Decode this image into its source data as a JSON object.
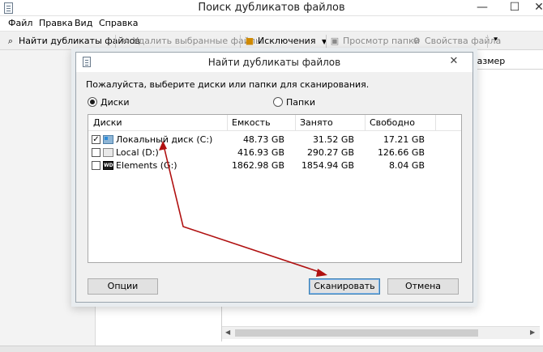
{
  "window": {
    "title": "Поиск дубликатов файлов",
    "controls": {
      "minimize": "—",
      "maximize": "☐",
      "close": "✕"
    }
  },
  "menu": [
    "Файл",
    "Правка",
    "Вид",
    "Справка"
  ],
  "toolbar": {
    "find_duplicates": "Найти дубликаты файлов",
    "delete_selected": "Удалить выбранные файлы",
    "exclusions": "Исключения",
    "view_folder": "Просмотр папки",
    "file_properties": "Свойства файла",
    "overflow": "⯆"
  },
  "main": {
    "column_size": "Размер"
  },
  "dialog": {
    "title": "Найти дубликаты файлов",
    "close": "✕",
    "prompt": "Пожалуйста, выберите диски или папки для сканирования.",
    "radio_disks": "Диски",
    "radio_folders": "Папки",
    "selected_mode": "disks",
    "columns": [
      "Диски",
      "Емкость",
      "Занято",
      "Свободно"
    ],
    "drives": [
      {
        "name": "Локальный диск (C:)",
        "capacity": "48.73 GB",
        "used": "31.52 GB",
        "free": "17.21 GB",
        "checked": true,
        "icon": "system-drive-icon"
      },
      {
        "name": "Local (D:)",
        "capacity": "416.93 GB",
        "used": "290.27 GB",
        "free": "126.66 GB",
        "checked": false,
        "icon": "local-drive-icon"
      },
      {
        "name": "Elements (G:)",
        "capacity": "1862.98 GB",
        "used": "1854.94 GB",
        "free": "8.04 GB",
        "checked": false,
        "icon": "wd-drive-icon"
      }
    ],
    "wd_badge": "WD",
    "check_mark": "✓",
    "buttons": {
      "options": "Опции",
      "scan": "Сканировать",
      "cancel": "Отмена"
    }
  },
  "colors": {
    "annotation_arrow": "#b01010",
    "default_button_border": "#3c7fb1"
  }
}
